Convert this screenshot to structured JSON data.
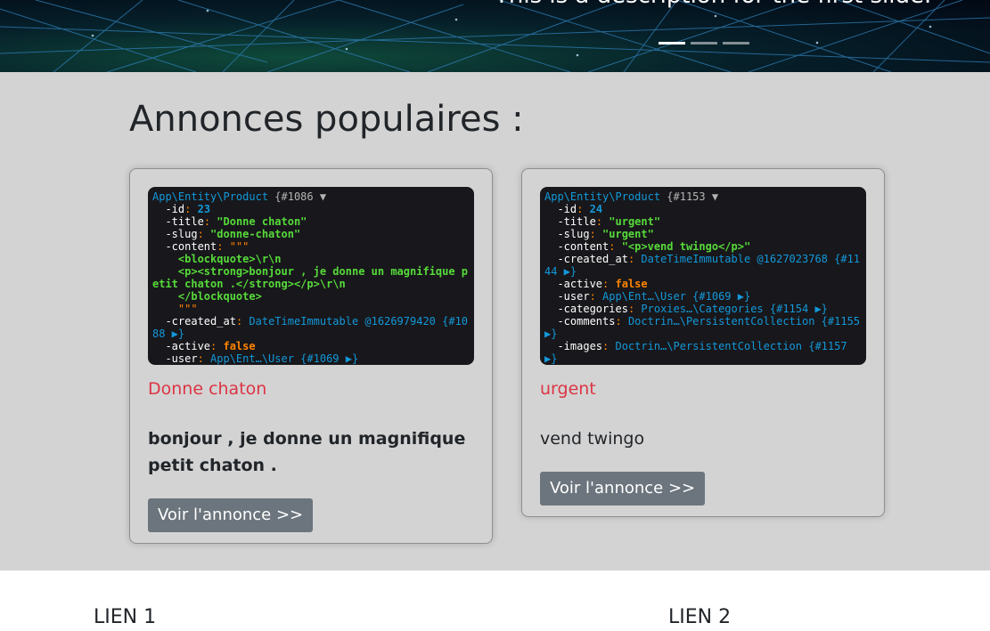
{
  "hero": {
    "caption": "This is a description for the first slide.",
    "slides": [
      "slide-1",
      "slide-2",
      "slide-3"
    ],
    "colors": {
      "background": "#06202a",
      "net_lines": "#2f7fb8"
    }
  },
  "popular": {
    "heading": "Annonces populaires :",
    "cards": [
      {
        "dump": {
          "class": "App\\Entity\\Product",
          "ref": "{#1086 ▼",
          "id": "23",
          "title": "\"Donne chaton\"",
          "slug": "\"donne-chaton\"",
          "content_open": "\"\"\"",
          "content_lines": [
            "<blockquote>\\r\\n",
            "<p><strong>bonjour , je donne un magnifique petit chaton .</strong></p>\\r\\n",
            "</blockquote>"
          ],
          "content_close": "\"\"\"",
          "created_at": "DateTimeImmutable @1626979420 {#1088 ▶}",
          "active": "false",
          "user": "App\\Ent…\\User {#1069 ▶}"
        },
        "title": "Donne chaton",
        "content": "bonjour , je donne un magnifique petit chaton .",
        "button": "Voir l'annonce >>"
      },
      {
        "dump": {
          "class": "App\\Entity\\Product",
          "ref": "{#1153 ▼",
          "id": "24",
          "title": "\"urgent\"",
          "slug": "\"urgent\"",
          "content": "\"<p>vend twingo</p>\"",
          "created_at": "DateTimeImmutable @1627023768 {#1144 ▶}",
          "active": "false",
          "user": "App\\Ent…\\User {#1069 ▶}",
          "categories": "Proxies…\\Categories {#1154 ▶}",
          "comments": "Doctrin…\\PersistentCollection {#1155 ▶}",
          "images": "Doctrin…\\PersistentCollection {#1157 ▶}"
        },
        "title": "urgent",
        "content": "vend twingo",
        "button": "Voir l'annonce >>"
      }
    ]
  },
  "footer": {
    "link1": "LIEN 1",
    "link2": "LIEN 2"
  }
}
